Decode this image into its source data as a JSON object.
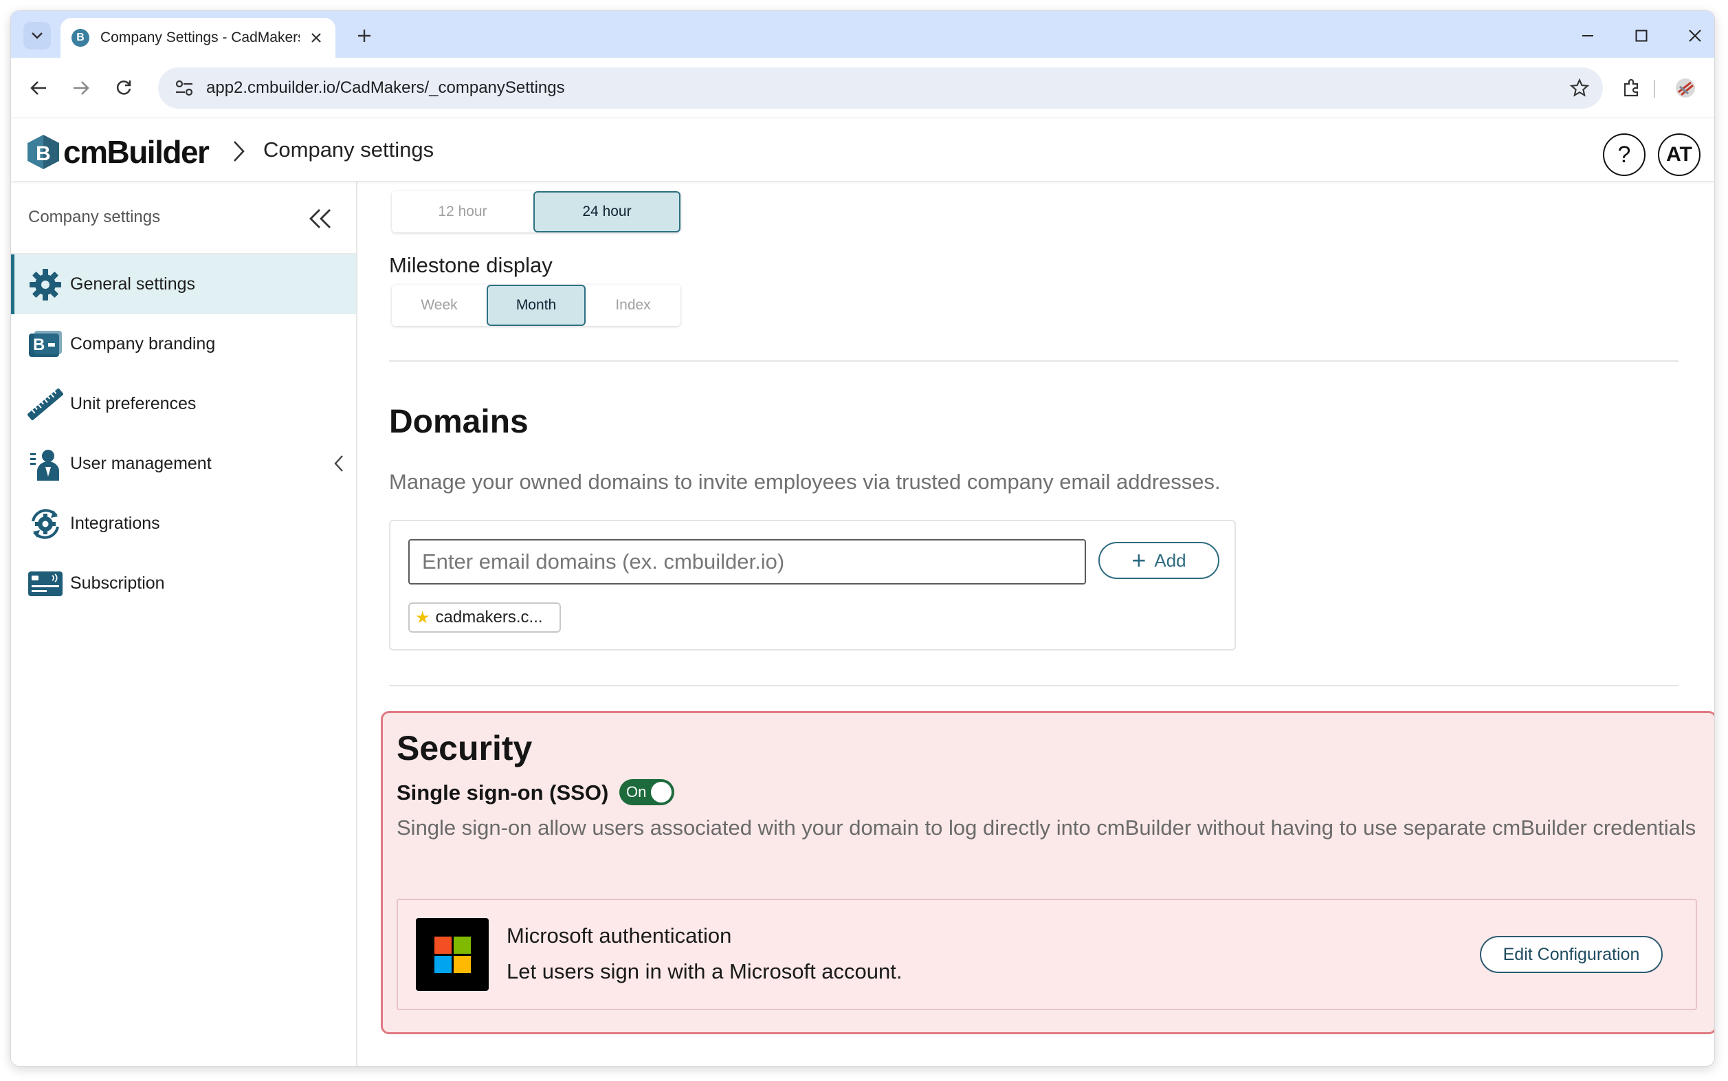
{
  "browser": {
    "tab_title": "Company Settings - CadMakers",
    "url": "app2.cmbuilder.io/CadMakers/_companySettings"
  },
  "header": {
    "logo_text": "cmBuilder",
    "breadcrumb_title": "Company settings",
    "help_label": "?",
    "avatar_initials": "AT"
  },
  "sidebar": {
    "title": "Company settings",
    "items": [
      {
        "label": "General settings",
        "icon": "gear-icon",
        "active": true
      },
      {
        "label": "Company branding",
        "icon": "branding-icon"
      },
      {
        "label": "Unit preferences",
        "icon": "ruler-icon"
      },
      {
        "label": "User management",
        "icon": "users-icon"
      },
      {
        "label": "Integrations",
        "icon": "integrations-icon"
      },
      {
        "label": "Subscription",
        "icon": "card-icon"
      }
    ]
  },
  "general": {
    "clock_options": [
      "12 hour",
      "24 hour"
    ],
    "clock_selected": "24 hour",
    "milestone_label": "Milestone display",
    "milestone_options": [
      "Week",
      "Month",
      "Index"
    ],
    "milestone_selected": "Month"
  },
  "domains": {
    "title": "Domains",
    "description": "Manage your owned domains to invite employees via trusted company email addresses.",
    "input_placeholder": "Enter email domains (ex. cmbuilder.io)",
    "add_label": "Add",
    "chips": [
      "cadmakers.c..."
    ]
  },
  "security": {
    "title": "Security",
    "sso_label": "Single sign-on (SSO)",
    "sso_toggle": "On",
    "sso_description": "Single sign-on allow users associated with your domain to log directly into cmBuilder without having to use separate cmBuilder credentials",
    "microsoft": {
      "title": "Microsoft authentication",
      "subtitle": "Let users sign in with a Microsoft account.",
      "edit_label": "Edit Configuration",
      "logo_colors": [
        "#f25022",
        "#7fba00",
        "#00a4ef",
        "#ffb900"
      ]
    },
    "border_color": "#e07a83",
    "background_color": "#fbe8e8"
  },
  "colors": {
    "accent": "#1f6f86",
    "active_bg": "#e1f0f2",
    "toggle_on": "#1d6b3c"
  }
}
